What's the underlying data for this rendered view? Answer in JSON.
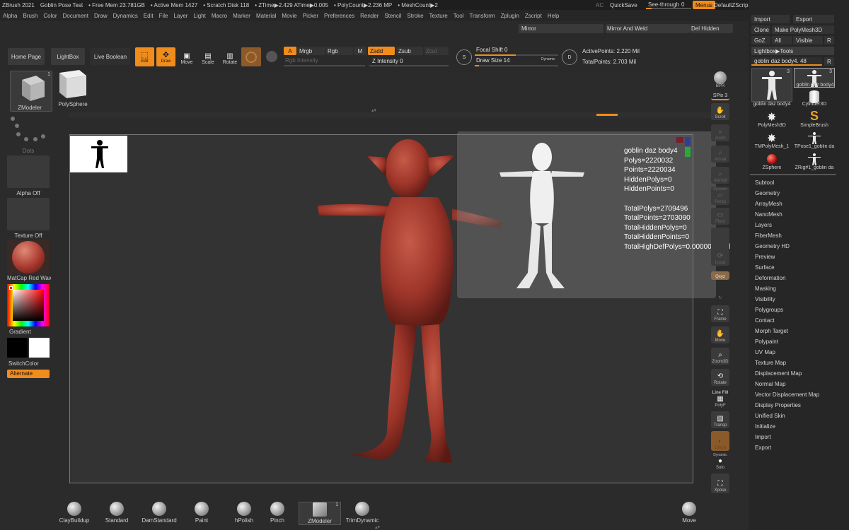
{
  "titlebar": {
    "app": "ZBrush 2021",
    "doc": "Goblin Pose Test",
    "free_mem": "• Free Mem 23.781GB",
    "active_mem": "• Active Mem 1427",
    "scratch": "• Scratch Disk 118",
    "ztime": "• ZTime▶2.429 ATime▶0.005",
    "polycount": "• PolyCount▶2.236 MP",
    "meshcount": "• MeshCount▶2",
    "ac": "AC",
    "quicksave": "QuickSave",
    "see_through": "See-through",
    "see_through_value": "0",
    "see_through_fraction": 0.0,
    "menus": "Menus",
    "script": "DefaultZScript"
  },
  "menubar": [
    "Alpha",
    "Brush",
    "Color",
    "Document",
    "Draw",
    "Dynamics",
    "Edit",
    "File",
    "Layer",
    "Light",
    "Macro",
    "Marker",
    "Material",
    "Movie",
    "Picker",
    "Preferences",
    "Render",
    "Stencil",
    "Stroke",
    "Texture",
    "Tool",
    "Transform",
    "Zplugin",
    "Zscript",
    "Help"
  ],
  "shelf": {
    "home": "Home Page",
    "lightbox": "LightBox",
    "live_boolean": "Live Boolean",
    "edit": "Edit",
    "draw": "Draw",
    "move": "Move",
    "scale": "Scale",
    "rotate": "Rotate",
    "a": "A",
    "mrgb": "Mrgb",
    "rgb": "Rgb",
    "m": "M",
    "zadd": "Zadd",
    "zsub": "Zsub",
    "zcut": "Zcut",
    "rgb_intensity": "Rgb Intensity",
    "z_intensity": "Z Intensity 0",
    "focal_shift": "Focal Shift 0",
    "draw_size": "Draw Size 14",
    "dynamic": "Dynamic",
    "active_points": "ActivePoints: 2.220 Mil",
    "total_points": "TotalPoints: 2.703 Mil",
    "mirror": "Mirror",
    "mirror_weld": "Mirror And Weld",
    "del_hidden": "Del Hidden"
  },
  "left": {
    "zmodeler": "ZModeler",
    "zmodeler_count": "1",
    "polysphere": "PolySphere",
    "dots": "Dots",
    "alpha": "Alpha Off",
    "texture": "Texture Off",
    "matcap": "MatCap Red Wax",
    "gradient": "Gradient",
    "switchcolor": "SwitchColor",
    "alternate": "Alternate"
  },
  "info": {
    "name": "goblin daz body4",
    "polys": "Polys=2220032",
    "points": "Points=2220034",
    "hidden_polys": "HiddenPolys=0",
    "hidden_points": "HiddenPoints=0",
    "total_polys": "TotalPolys=2709496",
    "total_points": "TotalPoints=2703090",
    "total_hidden_polys": "TotalHiddenPolys=0",
    "total_hidden_points": "TotalHiddenPoints=0",
    "total_hidef": "TotalHighDefPolys=0.0000000 Mil"
  },
  "rightstrip": {
    "bpr": "BPR",
    "spix": "SPix 3",
    "scroll": "Scroll",
    "zoom": "Zoom",
    "actual": "Actual",
    "aahalf": "AAHalf",
    "dynamic": "Dynamic",
    "persp": "Persp",
    "floor": "Floor",
    "local": "Local",
    "xyz": "Qxyz",
    "frame": "Frame",
    "move": "Move",
    "zoom3d": "Zoom3D",
    "rotate": "Rotate",
    "linefill": "Line Fill",
    "polyf": "PolyF",
    "transp": "Transp",
    "ghost": "Ghost",
    "dynamic2": "Dynamic",
    "solo": "Solo",
    "xpose": "Xpose"
  },
  "tool": {
    "import": "Import",
    "export": "Export",
    "clone": "Clone",
    "make_polymesh": "Make PolyMesh3D",
    "goz": "GoZ",
    "all": "All",
    "visible": "Visible",
    "r": "R",
    "lightbox_tools": "Lightbox▶Tools",
    "current": "goblin daz body4. 48",
    "items": [
      {
        "label": "goblin daz body4",
        "count": "3"
      },
      {
        "label": "goblin daz body4",
        "count": "3"
      },
      {
        "label": "Cylinder3D",
        "count": ""
      },
      {
        "label": "PolyMesh3D",
        "count": ""
      },
      {
        "label": "SimpleBrush",
        "count": ""
      },
      {
        "label": "TMPolyMesh_1",
        "count": ""
      },
      {
        "label": "TPose1_goblin da",
        "count": ""
      },
      {
        "label": "ZSphere",
        "count": ""
      },
      {
        "label": "ZRig#1_goblin da",
        "count": ""
      }
    ],
    "subpanels": [
      "Subtool",
      "Geometry",
      "ArrayMesh",
      "NanoMesh",
      "Layers",
      "FiberMesh",
      "Geometry HD",
      "Preview",
      "Surface",
      "Deformation",
      "Masking",
      "Visibility",
      "Polygroups",
      "Contact",
      "Morph Target",
      "Polypaint",
      "UV Map",
      "Texture Map",
      "Displacement Map",
      "Normal Map",
      "Vector Displacement Map",
      "Display Properties",
      "Unified Skin",
      "Initialize",
      "Import",
      "Export"
    ]
  },
  "brushes": [
    "ClayBuildup",
    "Standard",
    "DamStandard",
    "Paint",
    "hPolish",
    "Pinch",
    "ZModeler",
    "TrimDynamic",
    "Move"
  ],
  "brush_zmodeler_count": "1",
  "colors": {
    "accent": "#f08c1c",
    "wax": "#a8382e",
    "panel": "#2b2b2b"
  }
}
